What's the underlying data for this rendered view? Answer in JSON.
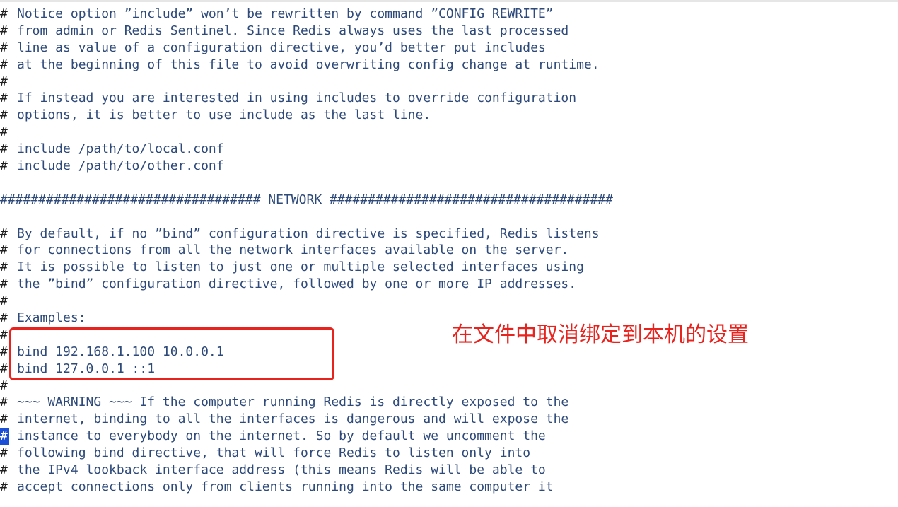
{
  "editor": {
    "lines": [
      {
        "prefix": "#",
        "text": "Notice option ”include” won’t be rewritten by command ”CONFIG REWRITE”"
      },
      {
        "prefix": "#",
        "text": "from admin or Redis Sentinel. Since Redis always uses the last processed"
      },
      {
        "prefix": "#",
        "text": "line as value of a configuration directive, you’d better put includes"
      },
      {
        "prefix": "#",
        "text": "at the beginning of this file to avoid overwriting config change at runtime."
      },
      {
        "prefix": "#",
        "text": ""
      },
      {
        "prefix": "#",
        "text": "If instead you are interested in using includes to override configuration"
      },
      {
        "prefix": "#",
        "text": "options, it is better to use include as the last line."
      },
      {
        "prefix": "#",
        "text": ""
      },
      {
        "prefix": "#",
        "text": "include /path/to/local.conf"
      },
      {
        "prefix": "#",
        "text": "include /path/to/other.conf"
      },
      {
        "prefix": "",
        "text": ""
      },
      {
        "prefix": "",
        "text": "################################## NETWORK #####################################"
      },
      {
        "prefix": "",
        "text": ""
      },
      {
        "prefix": "#",
        "text": "By default, if no ”bind” configuration directive is specified, Redis listens"
      },
      {
        "prefix": "#",
        "text": "for connections from all the network interfaces available on the server."
      },
      {
        "prefix": "#",
        "text": "It is possible to listen to just one or multiple selected interfaces using"
      },
      {
        "prefix": "#",
        "text": "the ”bind” configuration directive, followed by one or more IP addresses."
      },
      {
        "prefix": "#",
        "text": ""
      },
      {
        "prefix": "#",
        "text": "Examples:"
      },
      {
        "prefix": "#",
        "text": ""
      },
      {
        "prefix": "#",
        "text": "bind 192.168.1.100 10.0.0.1"
      },
      {
        "prefix": "#",
        "text": "bind 127.0.0.1 ::1"
      },
      {
        "prefix": "#",
        "text": ""
      },
      {
        "prefix": "#",
        "text": "~~~ WARNING ~~~ If the computer running Redis is directly exposed to the"
      },
      {
        "prefix": "#",
        "text": "internet, binding to all the interfaces is dangerous and will expose the"
      },
      {
        "prefix": "#",
        "text": "instance to everybody on the internet. So by default we uncomment the"
      },
      {
        "prefix": "#",
        "text": "following bind directive, that will force Redis to listen only into"
      },
      {
        "prefix": "#",
        "text": "the IPv4 lookback interface address (this means Redis will be able to"
      },
      {
        "prefix": "#",
        "text": "accept connections only from clients running into the same computer it"
      }
    ],
    "cursor_line": 25
  },
  "annotation": {
    "text": "在文件中取消绑定到本机的设置",
    "color": "#e8231e"
  }
}
